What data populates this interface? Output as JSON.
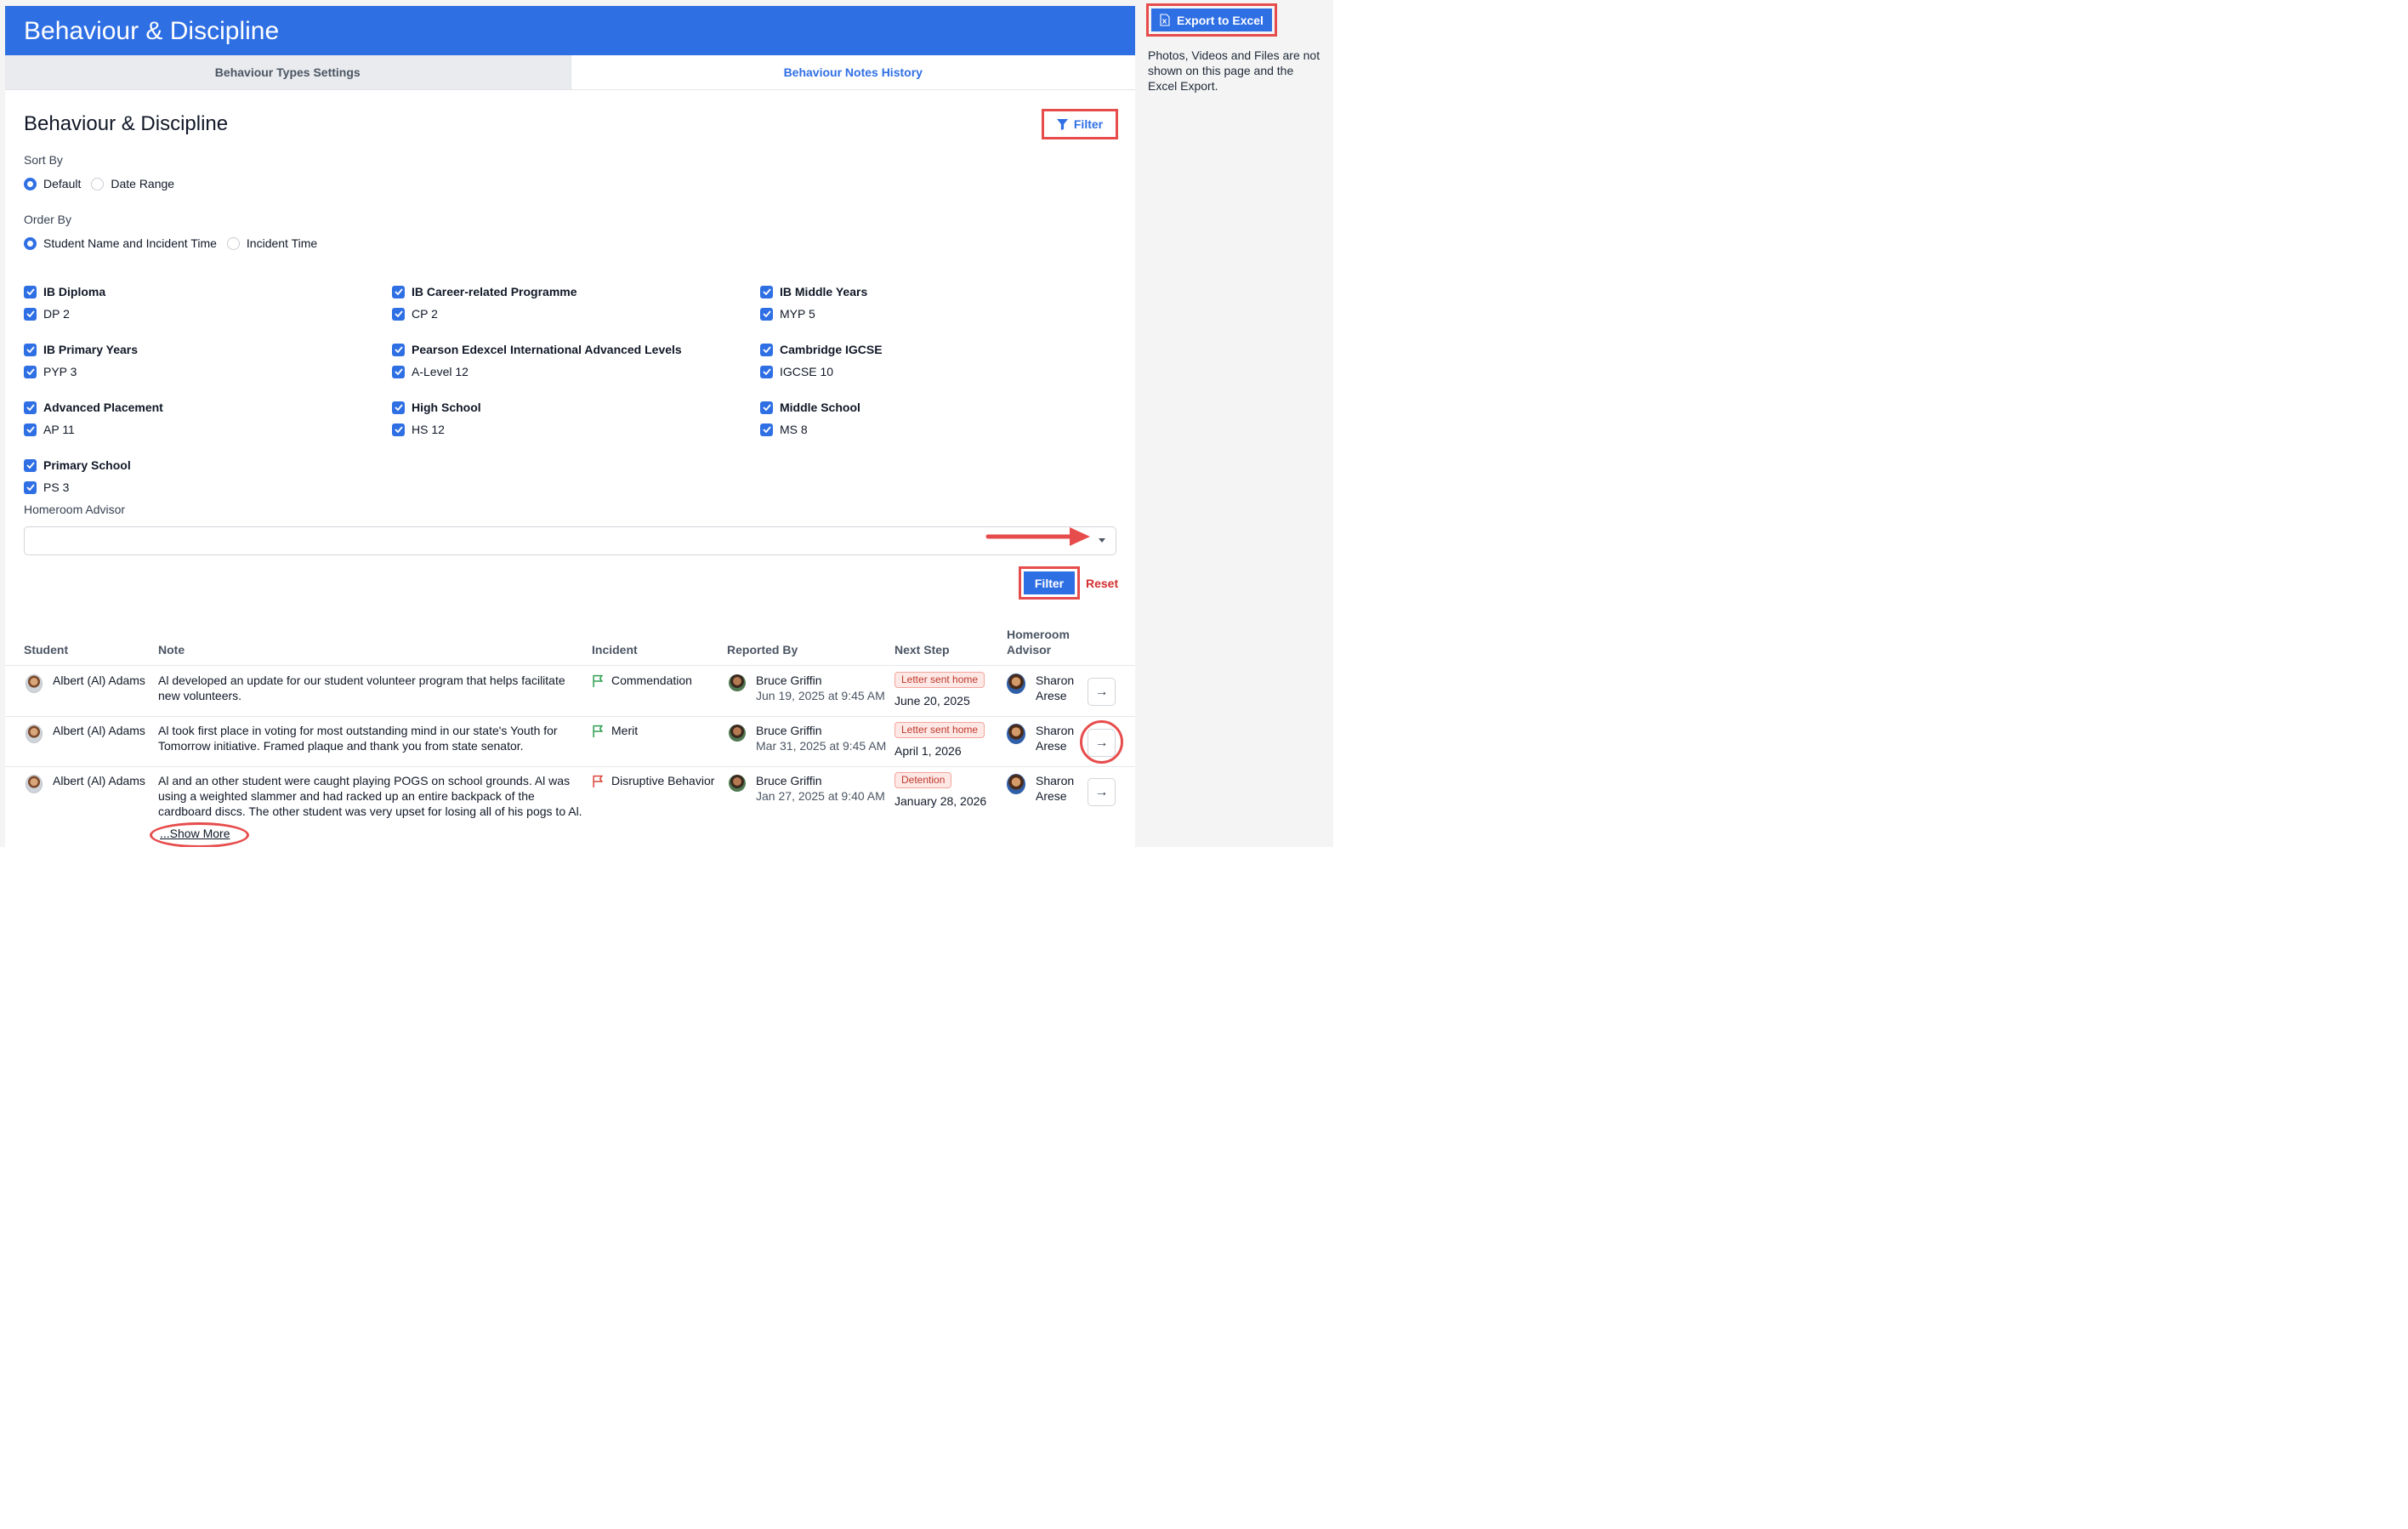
{
  "header": {
    "title": "Behaviour & Discipline"
  },
  "tabs": [
    {
      "label": "Behaviour Types Settings",
      "active": false
    },
    {
      "label": "Behaviour Notes History",
      "active": true
    }
  ],
  "page": {
    "title": "Behaviour & Discipline",
    "filter_label": "Filter"
  },
  "sort_by": {
    "label": "Sort By",
    "options": [
      "Default",
      "Date Range"
    ],
    "selected": "Default"
  },
  "order_by": {
    "label": "Order By",
    "options": [
      "Student Name and Incident Time",
      "Incident Time"
    ],
    "selected": "Student Name and Incident Time"
  },
  "programs": [
    {
      "name": "IB Diploma",
      "grade": "DP 2"
    },
    {
      "name": "IB Career-related Programme",
      "grade": "CP 2"
    },
    {
      "name": "IB Middle Years",
      "grade": "MYP 5"
    },
    {
      "name": "IB Primary Years",
      "grade": "PYP 3"
    },
    {
      "name": "Pearson Edexcel International Advanced Levels",
      "grade": "A-Level 12"
    },
    {
      "name": "Cambridge IGCSE",
      "grade": "IGCSE 10"
    },
    {
      "name": "Advanced Placement",
      "grade": "AP 11"
    },
    {
      "name": "High School",
      "grade": "HS 12"
    },
    {
      "name": "Middle School",
      "grade": "MS 8"
    },
    {
      "name": "Primary School",
      "grade": "PS 3"
    }
  ],
  "homeroom": {
    "label": "Homeroom Advisor",
    "value": ""
  },
  "actions": {
    "filter": "Filter",
    "reset": "Reset"
  },
  "table": {
    "headers": {
      "student": "Student",
      "note": "Note",
      "incident": "Incident",
      "reported_by": "Reported By",
      "next_step": "Next Step",
      "homeroom_1": "Homeroom",
      "homeroom_2": "Advisor"
    },
    "rows": [
      {
        "student": "Albert (Al) Adams",
        "note": "Al developed an update for our student volunteer program that helps facilitate new volunteers.",
        "incident": "Commendation",
        "incident_color": "#2e9e4f",
        "reporter": "Bruce Griffin",
        "reported_time": "Jun 19, 2025 at 9:45 AM",
        "next_step": "Letter sent home",
        "next_date": "June 20, 2025",
        "advisor_first": "Sharon",
        "advisor_last": "Arese"
      },
      {
        "student": "Albert (Al) Adams",
        "note": "Al took first place in voting for most outstanding mind in our state's Youth for Tomorrow initiative. Framed plaque and thank you from state senator.",
        "incident": "Merit",
        "incident_color": "#2e9e4f",
        "reporter": "Bruce Griffin",
        "reported_time": "Mar 31, 2025 at 9:45 AM",
        "next_step": "Letter sent home",
        "next_date": "April 1, 2026",
        "advisor_first": "Sharon",
        "advisor_last": "Arese"
      },
      {
        "student": "Albert (Al) Adams",
        "note": "Al and an other student were caught playing POGS on school grounds. Al was using a weighted slammer and had racked up an entire backpack of the cardboard discs. The other student was very upset for losing all of his pogs to Al.",
        "incident": "Disruptive Behavior",
        "incident_color": "#d9443a",
        "reporter": "Bruce Griffin",
        "reported_time": "Jan 27, 2025 at 9:40 AM",
        "next_step": "Detention",
        "next_date": "January 28, 2026",
        "advisor_first": "Sharon",
        "advisor_last": "Arese",
        "show_more": "...Show More"
      }
    ]
  },
  "export": {
    "label": "Export to Excel",
    "note": "Photos, Videos and Files are not shown on this page and the Excel Export."
  },
  "colors": {
    "primary": "#2f6fe4",
    "annotation": "#e74c4c",
    "reset": "#d42f2f"
  }
}
